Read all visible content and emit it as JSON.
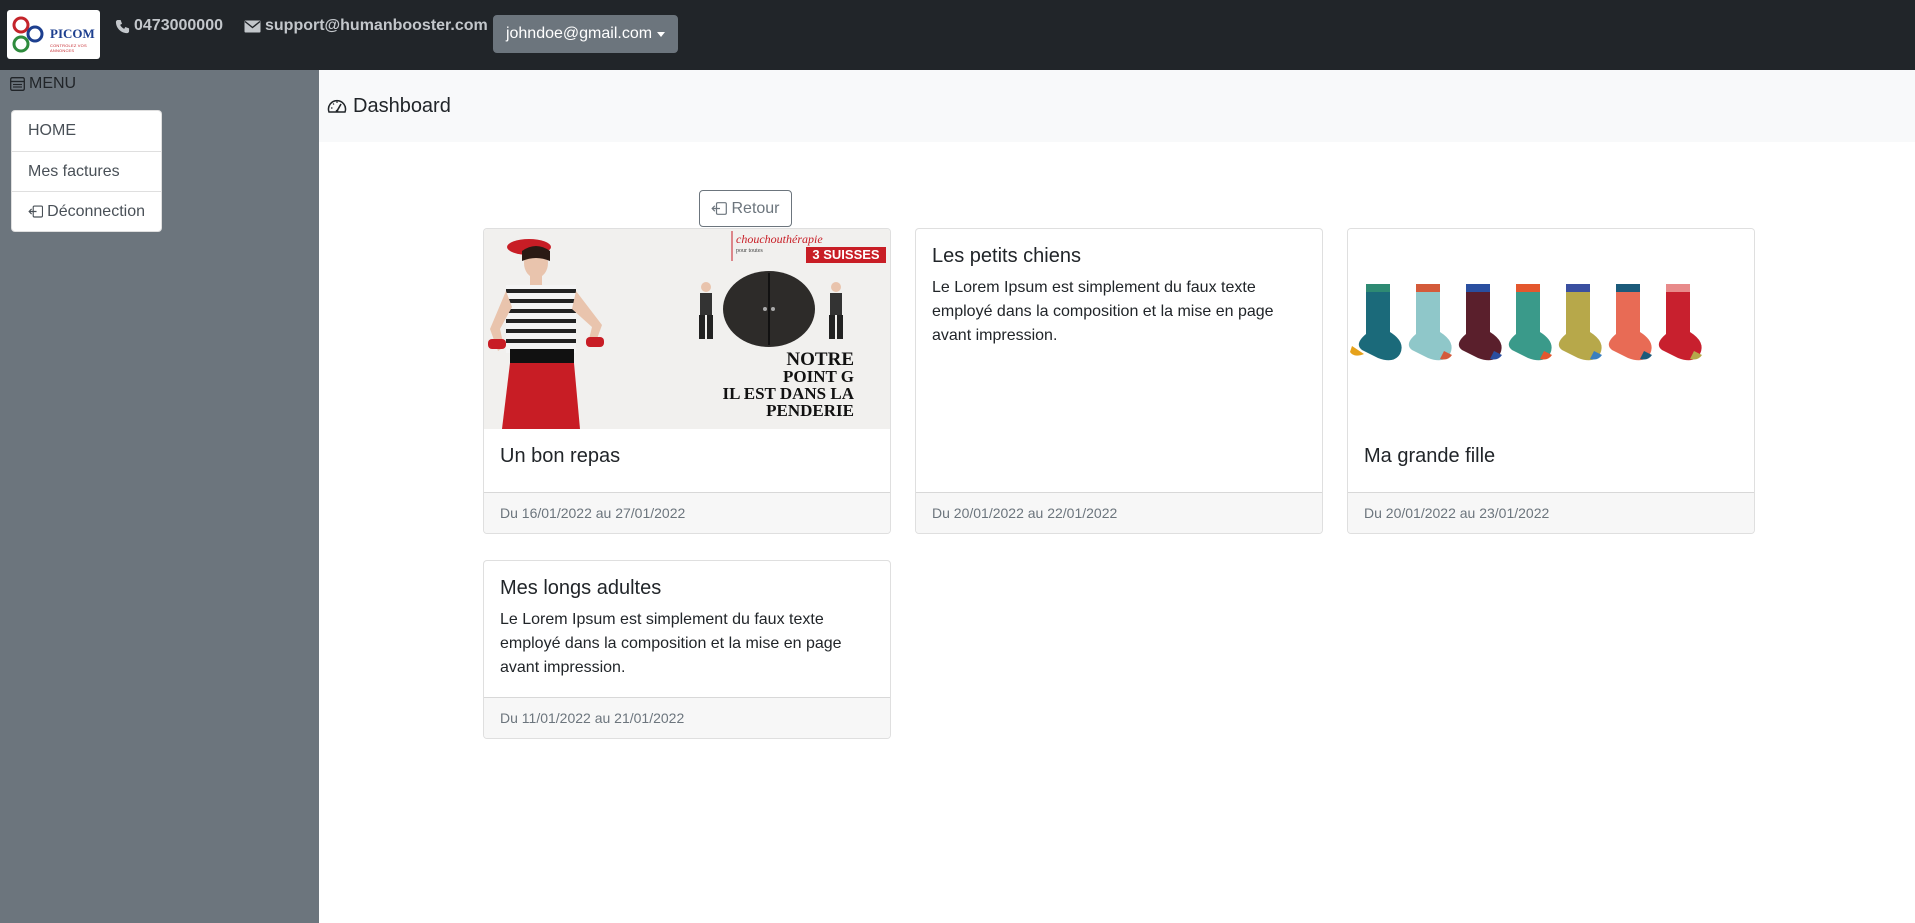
{
  "header": {
    "logo_text": "PICOM",
    "logo_subtitle": "CONTROLEZ VOS ANNONCES",
    "phone": "0473000000",
    "email": "support@humanbooster.com",
    "user_menu_label": "johndoe@gmail.com"
  },
  "sidebar": {
    "title": "MENU",
    "items": [
      {
        "label": "HOME"
      },
      {
        "label": "Mes factures"
      },
      {
        "label": "Déconnection"
      }
    ]
  },
  "main": {
    "title": "Dashboard",
    "back_label": "Retour",
    "cards": [
      {
        "title": "Un bon repas",
        "text": "",
        "footer": "Du 16/01/2022 au 27/01/2022",
        "image": {
          "brand_script": "chouchouthérapie",
          "brand_small": "pour toutes",
          "brand_badge": "3 SUISSES",
          "headline_1": "Notre",
          "headline_2": "point G",
          "headline_3": "il est dans la",
          "headline_4": "penderie"
        }
      },
      {
        "title": "Les petits chiens",
        "text": "Le Lorem Ipsum est simplement du faux texte employé dans la composition et la mise en page avant impression.",
        "footer": "Du 20/01/2022 au 22/01/2022"
      },
      {
        "title": "Ma grande fille",
        "text": "",
        "footer": "Du 20/01/2022 au 23/01/2022"
      },
      {
        "title": "Mes longs adultes",
        "text": "Le Lorem Ipsum est simplement du faux texte employé dans la composition et la mise en page avant impression.",
        "footer": "Du 11/01/2022 au 21/01/2022"
      }
    ]
  },
  "colors": {
    "topbar": "#212529",
    "sidebar": "#6c757d",
    "header_bg": "#f8f9fa",
    "accent_red": "#c4242a"
  }
}
